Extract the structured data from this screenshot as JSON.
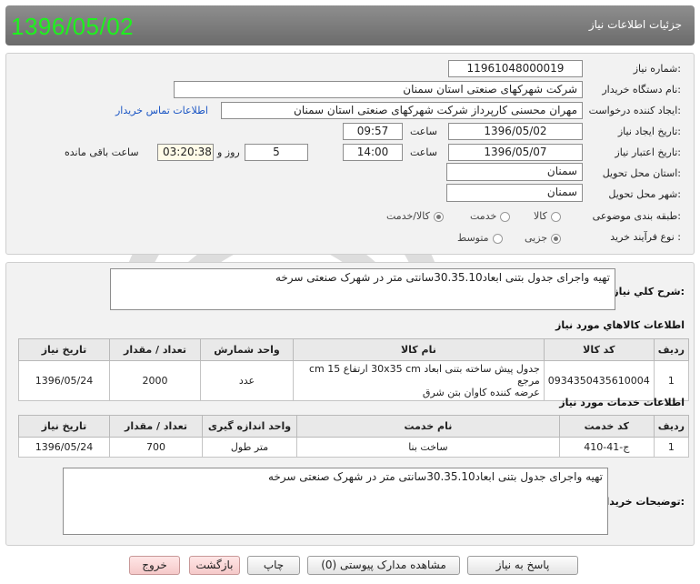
{
  "header": {
    "big_date": "1396/05/02",
    "title": "جزئیات اطلاعات نیاز"
  },
  "info": {
    "need_number_label": "شماره نیاز:",
    "need_number": "11961048000019",
    "buyer_name_label": "نام دستگاه خریدار:",
    "buyer_name": "شرکت شهرکهای صنعتی استان سمنان",
    "requester_label": "ایجاد کننده درخواست:",
    "requester": "مهران محسنی کارپرداز شرکت شهرکهای صنعتی استان سمنان",
    "contact_link": "اطلاعات تماس خریدار",
    "created_label": "تاریخ ایجاد نیاز:",
    "created_date": "1396/05/02",
    "time_label": "ساعت",
    "created_time": "09:57",
    "validity_label": "تاریخ اعتبار نیاز:",
    "validity_date": "1396/05/07",
    "validity_time": "14:00",
    "days_count": "5",
    "days_and_label": "روز و",
    "remaining_time": "03:20:38",
    "remaining_label": "ساعت باقی مانده",
    "province_label": "استان محل تحویل:",
    "province": "سمنان",
    "city_label": "شهر محل تحویل:",
    "city": "سمنان",
    "category_label": "طبقه بندی موضوعی:",
    "category_options": [
      "کالا",
      "خدمت",
      "کالا/خدمت"
    ],
    "category_selected": 2,
    "process_label": "نوع فرآیند خرید :",
    "process_options": [
      "جزیی",
      "متوسط"
    ],
    "process_selected": 0
  },
  "description": {
    "label": "شرح کلي نياز:",
    "text": "تهیه واجرای جدول بتنی ابعاد30.35.10سانتی متر در شهرک صنعتی سرخه"
  },
  "goods": {
    "title": "اطلاعات كالاهاي مورد نياز",
    "headers": [
      "رديف",
      "كد كالا",
      "نام كالا",
      "واحد شمارش",
      "تعداد / مقدار",
      "تاريخ نياز"
    ],
    "rows": [
      {
        "row": "1",
        "code": "0934350435610004",
        "name_line1": "جدول پیش ساخته بتنی ابعاد 30x35 cm ارتفاع cm 15 مرجع",
        "name_line2": "عرضه کننده کاوان بتن شرق",
        "unit": "عدد",
        "qty": "2000",
        "date": "1396/05/24"
      }
    ]
  },
  "services": {
    "title": "اطلاعات خدمات مورد نياز",
    "headers": [
      "رديف",
      "كد خدمت",
      "نام خدمت",
      "واحد اندازه گيری",
      "تعداد / مقدار",
      "تاريخ نياز"
    ],
    "rows": [
      {
        "row": "1",
        "code": "ج-41-410",
        "name": "ساخت بنا",
        "unit": "متر طول",
        "qty": "700",
        "date": "1396/05/24"
      }
    ]
  },
  "buyer_notes": {
    "label": "توضيحات خريدار:",
    "text": "تهیه واجرای جدول بتنی ابعاد30.35.10سانتی متر در شهرک صنعتی سرخه"
  },
  "buttons": {
    "reply": "پاسخ به نياز",
    "attachments": "مشاهده مدارک پيوستی (0)",
    "print": "چاپ",
    "back": "بازگشت",
    "exit": "خروج"
  },
  "colors": {
    "header_bg": "#7b7b7b",
    "date_green": "#1df21d",
    "link_blue": "#1a55c4",
    "panel_bg": "#f2f2f2"
  }
}
